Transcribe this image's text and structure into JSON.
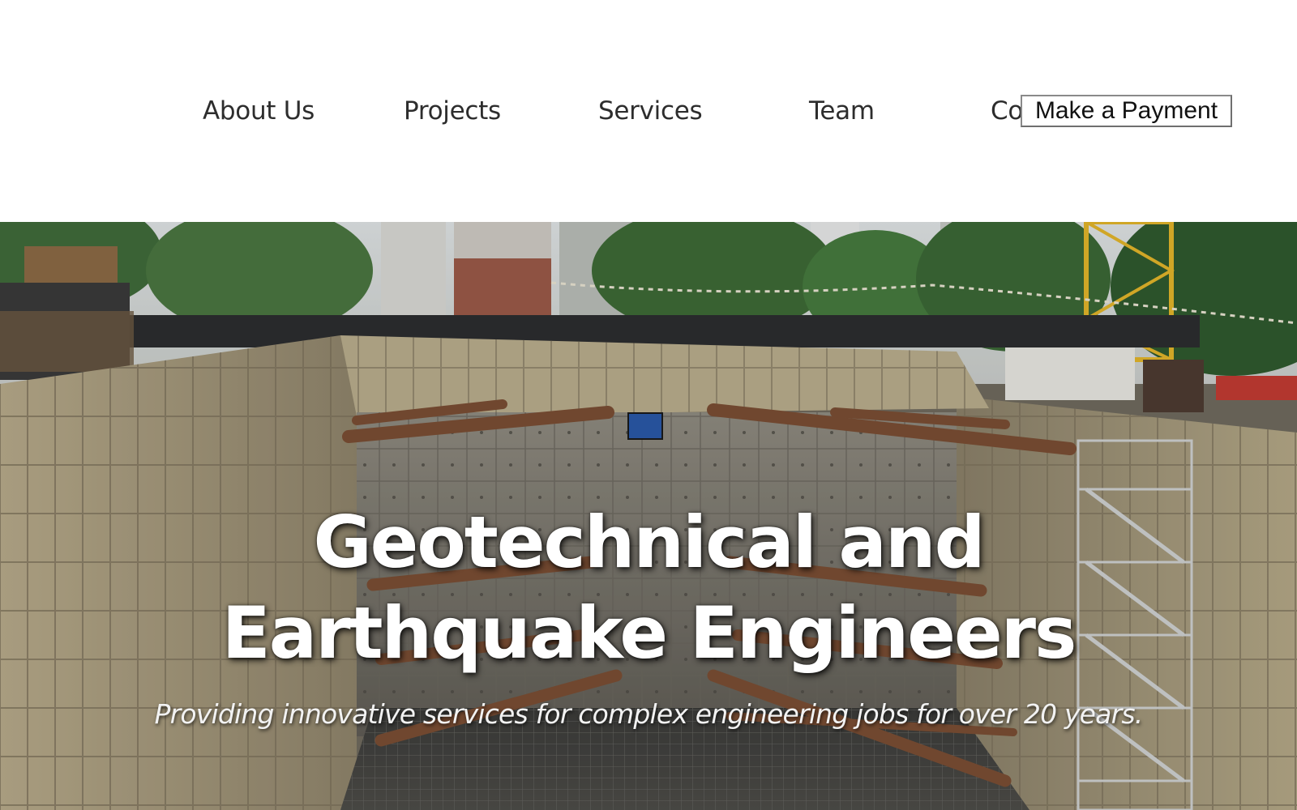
{
  "nav": {
    "items": [
      {
        "label": "About Us"
      },
      {
        "label": "Projects"
      },
      {
        "label": "Services"
      },
      {
        "label": "Team"
      },
      {
        "label": "Co"
      }
    ],
    "payment_button": "Make a Payment"
  },
  "hero": {
    "title_line1": "Geotechnical and",
    "title_line2": "Earthquake Engineers",
    "subtitle": "Providing innovative services for complex engineering jobs for over 20 years."
  }
}
